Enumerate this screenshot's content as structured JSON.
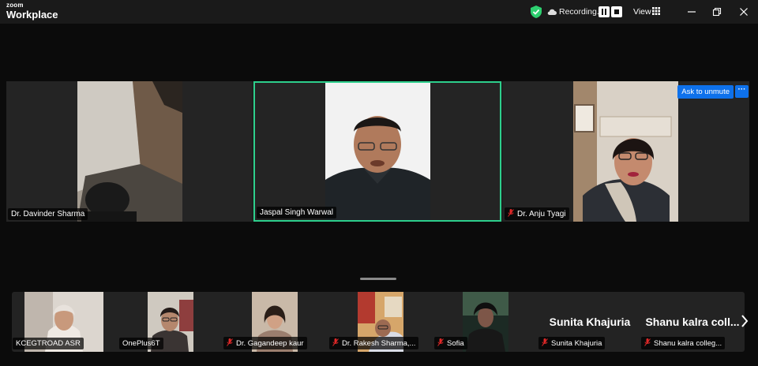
{
  "titlebar": {
    "brand_top": "zoom",
    "brand_bottom": "Workplace",
    "recording_label": "Recording...",
    "view_label": "View"
  },
  "stage": {
    "tiles": [
      {
        "name": "Dr. Davinder Sharma",
        "muted": false,
        "active_speaker": false
      },
      {
        "name": "Jaspal Singh Warwal",
        "muted": false,
        "active_speaker": true
      },
      {
        "name": "Dr. Anju Tyagi",
        "muted": true,
        "active_speaker": false
      }
    ],
    "ask_to_unmute_label": "Ask to unmute",
    "more_label": "···"
  },
  "gallery": {
    "tiles": [
      {
        "name": "KCEGTROAD ASR",
        "muted": false,
        "video": true
      },
      {
        "name": "OnePlus6T",
        "muted": false,
        "video": true
      },
      {
        "name": "Dr. Gagandeep kaur",
        "muted": true,
        "video": true
      },
      {
        "name": "Dr. Rakesh Sharma,...",
        "muted": true,
        "video": true
      },
      {
        "name": "Sofia",
        "muted": true,
        "video": true
      },
      {
        "name": "Sunita Khajuria",
        "muted": true,
        "video": false,
        "big_name": "Sunita Khajuria"
      },
      {
        "name": "Shanu kalra colleg...",
        "muted": true,
        "video": false,
        "big_name": "Shanu kalra coll..."
      }
    ]
  },
  "colors": {
    "active_speaker_border": "#2dcf8c",
    "accent_blue": "#0e71eb",
    "muted_red": "#e02828",
    "shield_green": "#2dcf6f"
  }
}
